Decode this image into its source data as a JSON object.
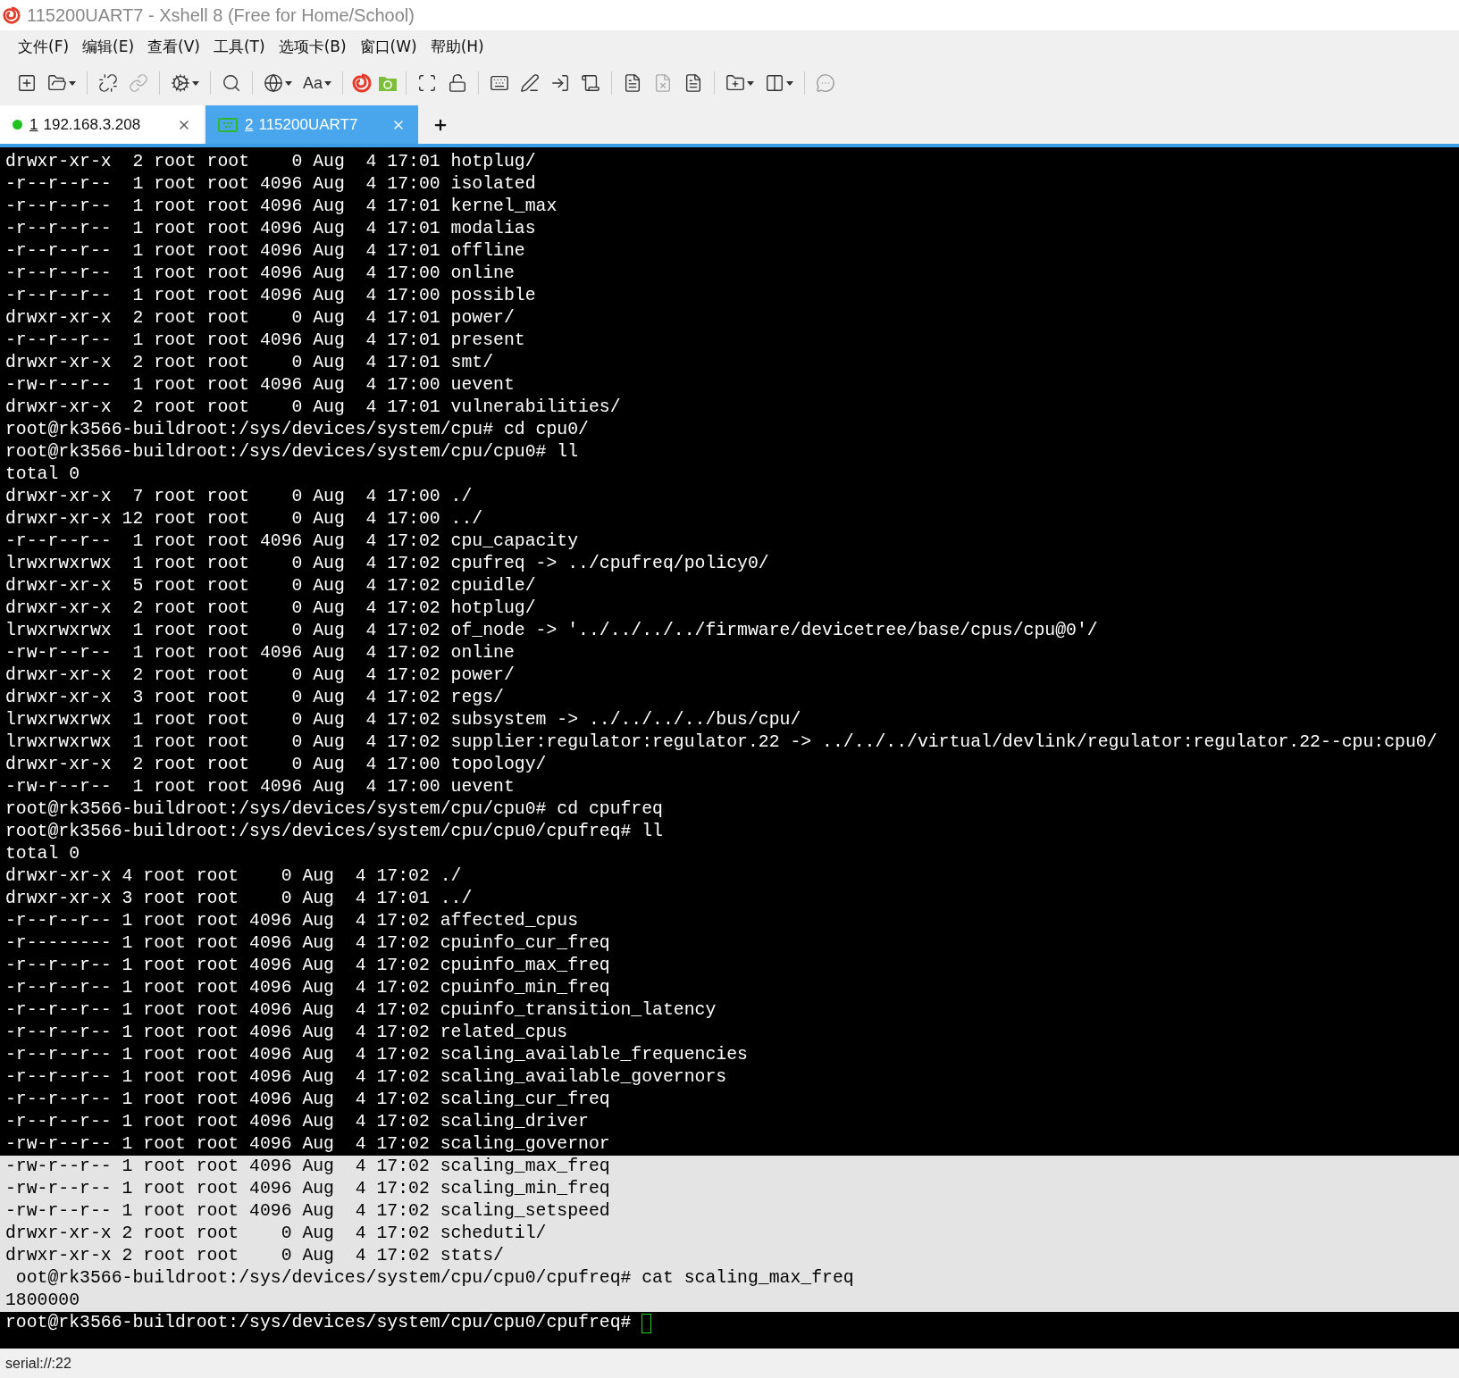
{
  "window": {
    "title": "115200UART7 - Xshell 8 (Free for Home/School)"
  },
  "menu": [
    "文件(F)",
    "编辑(E)",
    "查看(V)",
    "工具(T)",
    "选项卡(B)",
    "窗口(W)",
    "帮助(H)"
  ],
  "toolbar": {
    "font_button": "Aa"
  },
  "tabs": [
    {
      "kind": "session",
      "number": "1",
      "label": "192.168.3.208",
      "selected": false,
      "color": "#1fc01f"
    },
    {
      "kind": "serial",
      "number": "2",
      "label": "115200UART7",
      "selected": true
    }
  ],
  "terminal": {
    "lines": [
      {
        "text": "drwxr-xr-x  2 root root    0 Aug  4 17:01 hotplug/",
        "selected": false
      },
      {
        "text": "-r--r--r--  1 root root 4096 Aug  4 17:00 isolated",
        "selected": false
      },
      {
        "text": "-r--r--r--  1 root root 4096 Aug  4 17:01 kernel_max",
        "selected": false
      },
      {
        "text": "-r--r--r--  1 root root 4096 Aug  4 17:01 modalias",
        "selected": false
      },
      {
        "text": "-r--r--r--  1 root root 4096 Aug  4 17:01 offline",
        "selected": false
      },
      {
        "text": "-r--r--r--  1 root root 4096 Aug  4 17:00 online",
        "selected": false
      },
      {
        "text": "-r--r--r--  1 root root 4096 Aug  4 17:00 possible",
        "selected": false
      },
      {
        "text": "drwxr-xr-x  2 root root    0 Aug  4 17:01 power/",
        "selected": false
      },
      {
        "text": "-r--r--r--  1 root root 4096 Aug  4 17:01 present",
        "selected": false
      },
      {
        "text": "drwxr-xr-x  2 root root    0 Aug  4 17:01 smt/",
        "selected": false
      },
      {
        "text": "-rw-r--r--  1 root root 4096 Aug  4 17:00 uevent",
        "selected": false
      },
      {
        "text": "drwxr-xr-x  2 root root    0 Aug  4 17:01 vulnerabilities/",
        "selected": false
      },
      {
        "text": "root@rk3566-buildroot:/sys/devices/system/cpu# cd cpu0/",
        "selected": false
      },
      {
        "text": "root@rk3566-buildroot:/sys/devices/system/cpu/cpu0# ll",
        "selected": false
      },
      {
        "text": "total 0",
        "selected": false
      },
      {
        "text": "drwxr-xr-x  7 root root    0 Aug  4 17:00 ./",
        "selected": false
      },
      {
        "text": "drwxr-xr-x 12 root root    0 Aug  4 17:00 ../",
        "selected": false
      },
      {
        "text": "-r--r--r--  1 root root 4096 Aug  4 17:02 cpu_capacity",
        "selected": false
      },
      {
        "text": "lrwxrwxrwx  1 root root    0 Aug  4 17:02 cpufreq -> ../cpufreq/policy0/",
        "selected": false
      },
      {
        "text": "drwxr-xr-x  5 root root    0 Aug  4 17:02 cpuidle/",
        "selected": false
      },
      {
        "text": "drwxr-xr-x  2 root root    0 Aug  4 17:02 hotplug/",
        "selected": false
      },
      {
        "text": "lrwxrwxrwx  1 root root    0 Aug  4 17:02 of_node -> '../../../../firmware/devicetree/base/cpus/cpu@0'/",
        "selected": false
      },
      {
        "text": "-rw-r--r--  1 root root 4096 Aug  4 17:02 online",
        "selected": false
      },
      {
        "text": "drwxr-xr-x  2 root root    0 Aug  4 17:02 power/",
        "selected": false
      },
      {
        "text": "drwxr-xr-x  3 root root    0 Aug  4 17:02 regs/",
        "selected": false
      },
      {
        "text": "lrwxrwxrwx  1 root root    0 Aug  4 17:02 subsystem -> ../../../../bus/cpu/",
        "selected": false
      },
      {
        "text": "lrwxrwxrwx  1 root root    0 Aug  4 17:02 supplier:regulator:regulator.22 -> ../../../virtual/devlink/regulator:regulator.22--cpu:cpu0/",
        "selected": false
      },
      {
        "text": "drwxr-xr-x  2 root root    0 Aug  4 17:00 topology/",
        "selected": false
      },
      {
        "text": "-rw-r--r--  1 root root 4096 Aug  4 17:00 uevent",
        "selected": false
      },
      {
        "text": "root@rk3566-buildroot:/sys/devices/system/cpu/cpu0# cd cpufreq",
        "selected": false
      },
      {
        "text": "root@rk3566-buildroot:/sys/devices/system/cpu/cpu0/cpufreq# ll",
        "selected": false
      },
      {
        "text": "total 0",
        "selected": false
      },
      {
        "text": "drwxr-xr-x 4 root root    0 Aug  4 17:02 ./",
        "selected": false
      },
      {
        "text": "drwxr-xr-x 3 root root    0 Aug  4 17:01 ../",
        "selected": false
      },
      {
        "text": "-r--r--r-- 1 root root 4096 Aug  4 17:02 affected_cpus",
        "selected": false
      },
      {
        "text": "-r-------- 1 root root 4096 Aug  4 17:02 cpuinfo_cur_freq",
        "selected": false
      },
      {
        "text": "-r--r--r-- 1 root root 4096 Aug  4 17:02 cpuinfo_max_freq",
        "selected": false
      },
      {
        "text": "-r--r--r-- 1 root root 4096 Aug  4 17:02 cpuinfo_min_freq",
        "selected": false
      },
      {
        "text": "-r--r--r-- 1 root root 4096 Aug  4 17:02 cpuinfo_transition_latency",
        "selected": false
      },
      {
        "text": "-r--r--r-- 1 root root 4096 Aug  4 17:02 related_cpus",
        "selected": false
      },
      {
        "text": "-r--r--r-- 1 root root 4096 Aug  4 17:02 scaling_available_frequencies",
        "selected": false
      },
      {
        "text": "-r--r--r-- 1 root root 4096 Aug  4 17:02 scaling_available_governors",
        "selected": false
      },
      {
        "text": "-r--r--r-- 1 root root 4096 Aug  4 17:02 scaling_cur_freq",
        "selected": false
      },
      {
        "text": "-r--r--r-- 1 root root 4096 Aug  4 17:02 scaling_driver",
        "selected": false
      },
      {
        "text": "-rw-r--r-- 1 root root 4096 Aug  4 17:02 scaling_governor",
        "selected": false
      },
      {
        "text": "-rw-r--r-- 1 root root 4096 Aug  4 17:02 scaling_max_freq",
        "selected": true
      },
      {
        "text": "-rw-r--r-- 1 root root 4096 Aug  4 17:02 scaling_min_freq",
        "selected": true
      },
      {
        "text": "-rw-r--r-- 1 root root 4096 Aug  4 17:02 scaling_setspeed",
        "selected": true
      },
      {
        "text": "drwxr-xr-x 2 root root    0 Aug  4 17:02 schedutil/",
        "selected": true
      },
      {
        "text": "drwxr-xr-x 2 root root    0 Aug  4 17:02 stats/",
        "selected": true
      },
      {
        "text": " oot@rk3566-buildroot:/sys/devices/system/cpu/cpu0/cpufreq# cat scaling_max_freq",
        "selected": true
      },
      {
        "text": "1800000",
        "selected": true
      },
      {
        "text": "root@rk3566-buildroot:/sys/devices/system/cpu/cpu0/cpufreq# ",
        "selected": false,
        "cursor": true
      }
    ]
  },
  "status_bar": {
    "text": "serial://:22"
  }
}
